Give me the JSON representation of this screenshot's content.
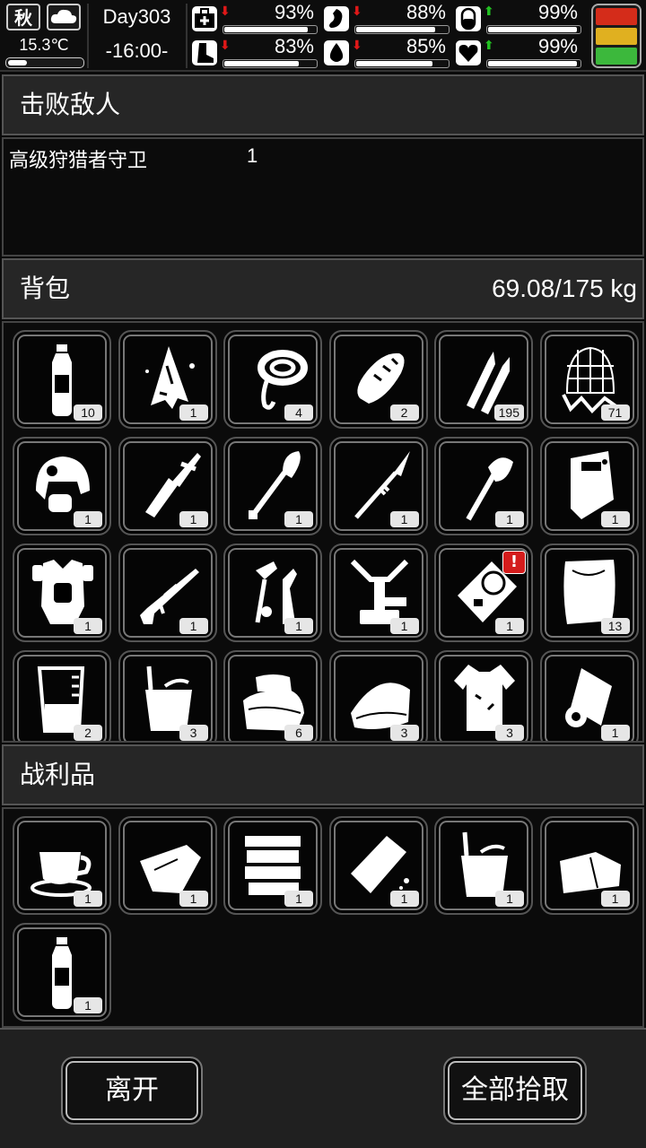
{
  "status": {
    "season": "秋",
    "weather_icon": "cloud-icon",
    "temperature": "15.3℃",
    "temperature_level": 0.25,
    "day": "Day303",
    "time": "-16:00-",
    "stats": [
      {
        "name": "health",
        "icon": "first-aid-icon",
        "trend": "down",
        "value": "93%",
        "level": 0.93
      },
      {
        "name": "hunger",
        "icon": "stomach-icon",
        "trend": "down",
        "value": "88%",
        "level": 0.88
      },
      {
        "name": "medicine",
        "icon": "pill-icon",
        "trend": "up",
        "value": "99%",
        "level": 0.99
      },
      {
        "name": "stamina",
        "icon": "boot-icon",
        "trend": "down",
        "value": "83%",
        "level": 0.83
      },
      {
        "name": "thirst",
        "icon": "water-drop-icon",
        "trend": "down",
        "value": "85%",
        "level": 0.85
      },
      {
        "name": "mood",
        "icon": "heart-icon",
        "trend": "up",
        "value": "99%",
        "level": 0.99
      }
    ],
    "traffic_light": [
      "#d42c1a",
      "#e0b020",
      "#3cb83c"
    ]
  },
  "defeated": {
    "title": "击败敌人",
    "enemies": [
      {
        "name": "高级狩猎者守卫",
        "count": "1"
      }
    ]
  },
  "backpack": {
    "title": "背包",
    "weight": "69.08/175 kg",
    "items": [
      {
        "icon": "water-bottle-icon",
        "count": "10"
      },
      {
        "icon": "torn-cloth-icon",
        "count": "1"
      },
      {
        "icon": "rope-coil-icon",
        "count": "4"
      },
      {
        "icon": "bread-icon",
        "count": "2"
      },
      {
        "icon": "rifle-bullets-icon",
        "count": "195"
      },
      {
        "icon": "net-icon",
        "count": "71"
      },
      {
        "icon": "tactical-helmet-icon",
        "count": "1"
      },
      {
        "icon": "knife-caliper-icon",
        "count": "1"
      },
      {
        "icon": "shovel-icon",
        "count": "1"
      },
      {
        "icon": "spear-icon",
        "count": "1"
      },
      {
        "icon": "axe-icon",
        "count": "1"
      },
      {
        "icon": "riot-shield-icon",
        "count": "1"
      },
      {
        "icon": "body-armor-icon",
        "count": "1"
      },
      {
        "icon": "sniper-rifle-icon",
        "count": "1"
      },
      {
        "icon": "tools-icon",
        "count": "1"
      },
      {
        "icon": "repair-stand-icon",
        "count": "1"
      },
      {
        "icon": "radar-device-icon",
        "count": "1",
        "alert": true
      },
      {
        "icon": "cloth-sheet-icon",
        "count": "13"
      },
      {
        "icon": "beaker-icon",
        "count": "2"
      },
      {
        "icon": "bucket-icon",
        "count": "3"
      },
      {
        "icon": "folded-towel-icon",
        "count": "6"
      },
      {
        "icon": "fabric-roll-icon",
        "count": "3"
      },
      {
        "icon": "ragged-shirt-icon",
        "count": "3"
      },
      {
        "icon": "paper-roll-icon",
        "count": "1"
      }
    ]
  },
  "loot": {
    "title": "战利品",
    "items": [
      {
        "icon": "coffee-cup-icon",
        "count": "1"
      },
      {
        "icon": "cloth-scrap-icon",
        "count": "1"
      },
      {
        "icon": "stacked-cloth-icon",
        "count": "1"
      },
      {
        "icon": "soap-bar-icon",
        "count": "1"
      },
      {
        "icon": "bucket-icon",
        "count": "1"
      },
      {
        "icon": "folded-fabric-icon",
        "count": "1"
      },
      {
        "icon": "water-bottle-icon",
        "count": "1"
      }
    ]
  },
  "buttons": {
    "leave": "离开",
    "take_all": "全部拾取"
  },
  "alert_mark": "!"
}
